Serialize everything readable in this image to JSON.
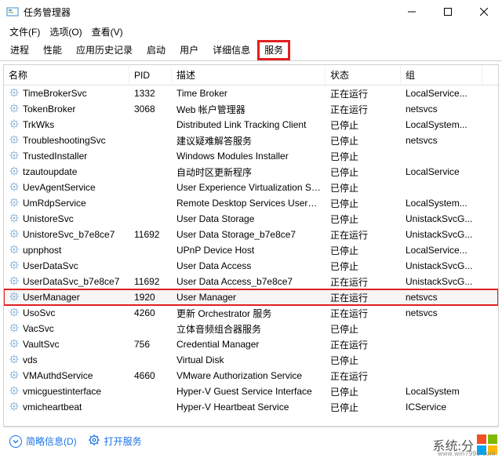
{
  "title": "任务管理器",
  "menu": {
    "file": "文件(F)",
    "options": "选项(O)",
    "view": "查看(V)"
  },
  "tabs": [
    "进程",
    "性能",
    "应用历史记录",
    "启动",
    "用户",
    "详细信息",
    "服务"
  ],
  "tabs_active_index": 6,
  "columns": {
    "name": "名称",
    "pid": "PID",
    "desc": "描述",
    "status": "状态",
    "group": "组"
  },
  "rows": [
    {
      "name": "TimeBrokerSvc",
      "pid": "1332",
      "desc": "Time Broker",
      "status": "正在运行",
      "group": "LocalService...",
      "sel": false
    },
    {
      "name": "TokenBroker",
      "pid": "3068",
      "desc": "Web 帐户管理器",
      "status": "正在运行",
      "group": "netsvcs",
      "sel": false
    },
    {
      "name": "TrkWks",
      "pid": "",
      "desc": "Distributed Link Tracking Client",
      "status": "已停止",
      "group": "LocalSystem...",
      "sel": false
    },
    {
      "name": "TroubleshootingSvc",
      "pid": "",
      "desc": "建议疑难解答服务",
      "status": "已停止",
      "group": "netsvcs",
      "sel": false
    },
    {
      "name": "TrustedInstaller",
      "pid": "",
      "desc": "Windows Modules Installer",
      "status": "已停止",
      "group": "",
      "sel": false
    },
    {
      "name": "tzautoupdate",
      "pid": "",
      "desc": "自动时区更新程序",
      "status": "已停止",
      "group": "LocalService",
      "sel": false
    },
    {
      "name": "UevAgentService",
      "pid": "",
      "desc": "User Experience Virtualization Se...",
      "status": "已停止",
      "group": "",
      "sel": false
    },
    {
      "name": "UmRdpService",
      "pid": "",
      "desc": "Remote Desktop Services UserM...",
      "status": "已停止",
      "group": "LocalSystem...",
      "sel": false
    },
    {
      "name": "UnistoreSvc",
      "pid": "",
      "desc": "User Data Storage",
      "status": "已停止",
      "group": "UnistackSvcG...",
      "sel": false
    },
    {
      "name": "UnistoreSvc_b7e8ce7",
      "pid": "11692",
      "desc": "User Data Storage_b7e8ce7",
      "status": "正在运行",
      "group": "UnistackSvcG...",
      "sel": false
    },
    {
      "name": "upnphost",
      "pid": "",
      "desc": "UPnP Device Host",
      "status": "已停止",
      "group": "LocalService...",
      "sel": false
    },
    {
      "name": "UserDataSvc",
      "pid": "",
      "desc": "User Data Access",
      "status": "已停止",
      "group": "UnistackSvcG...",
      "sel": false
    },
    {
      "name": "UserDataSvc_b7e8ce7",
      "pid": "11692",
      "desc": "User Data Access_b7e8ce7",
      "status": "正在运行",
      "group": "UnistackSvcG...",
      "sel": false
    },
    {
      "name": "UserManager",
      "pid": "1920",
      "desc": "User Manager",
      "status": "正在运行",
      "group": "netsvcs",
      "sel": true
    },
    {
      "name": "UsoSvc",
      "pid": "4260",
      "desc": "更新 Orchestrator 服务",
      "status": "正在运行",
      "group": "netsvcs",
      "sel": false
    },
    {
      "name": "VacSvc",
      "pid": "",
      "desc": "立体音频组合器服务",
      "status": "已停止",
      "group": "",
      "sel": false
    },
    {
      "name": "VaultSvc",
      "pid": "756",
      "desc": "Credential Manager",
      "status": "正在运行",
      "group": "",
      "sel": false
    },
    {
      "name": "vds",
      "pid": "",
      "desc": "Virtual Disk",
      "status": "已停止",
      "group": "",
      "sel": false
    },
    {
      "name": "VMAuthdService",
      "pid": "4660",
      "desc": "VMware Authorization Service",
      "status": "正在运行",
      "group": "",
      "sel": false
    },
    {
      "name": "vmicguestinterface",
      "pid": "",
      "desc": "Hyper-V Guest Service Interface",
      "status": "已停止",
      "group": "LocalSystem",
      "sel": false
    },
    {
      "name": "vmicheartbeat",
      "pid": "",
      "desc": "Hyper-V Heartbeat Service",
      "status": "已停止",
      "group": "ICService",
      "sel": false
    }
  ],
  "footer": {
    "brief": "简略信息(D)",
    "open": "打开服务"
  },
  "watermark": {
    "text": "系统:分",
    "url": "www.win7999.com"
  }
}
